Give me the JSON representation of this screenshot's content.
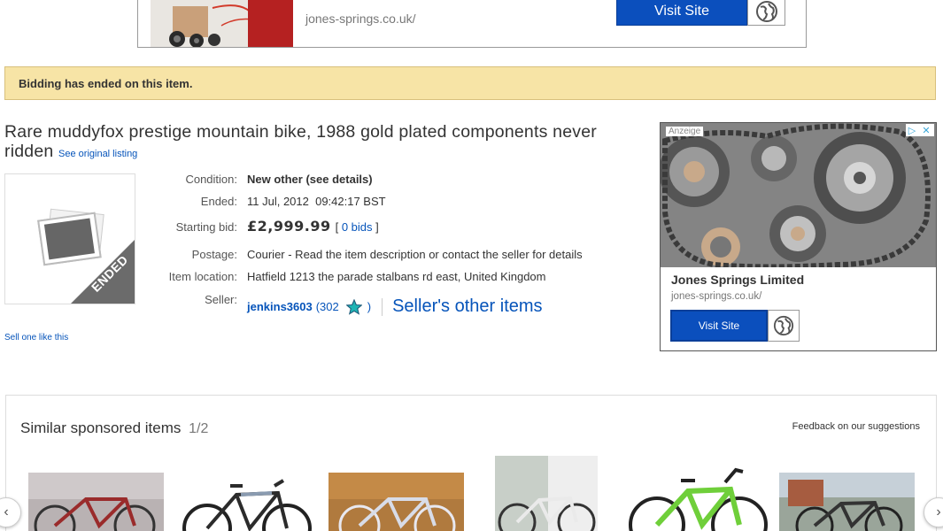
{
  "top_ad": {
    "url": "jones-springs.co.uk/",
    "button_label": "Visit Site"
  },
  "status": {
    "message": "Bidding has ended on this item."
  },
  "item": {
    "title": "Rare muddyfox prestige mountain bike, 1988 gold plated components never ridden",
    "original_link": "See original listing",
    "thumbnail_badge": "ENDED",
    "sell_link": "Sell one like this"
  },
  "details": {
    "condition_label": "Condition:",
    "condition_value": "New other (see details)",
    "ended_label": "Ended:",
    "ended_value": "11 Jul, 2012  09:42:17 BST",
    "starting_bid_label": "Starting bid:",
    "starting_bid_value": "£2,999.99",
    "bids_open": "[",
    "bids_link": "0 bids",
    "bids_close": "]",
    "postage_label": "Postage:",
    "postage_value": "Courier - Read the item description or contact the seller for details",
    "location_label": "Item location:",
    "location_value": "Hatfield 1213 the parade stalbans rd east, United Kingdom",
    "seller_label": "Seller:",
    "seller_name": "jenkins3603",
    "seller_score": "(302",
    "seller_score_close": ")",
    "seller_other_items": "Seller's other items"
  },
  "side_ad": {
    "tag": "Anzeige",
    "company": "Jones Springs Limited",
    "url": "jones-springs.co.uk/",
    "button_label": "Visit Site"
  },
  "similar": {
    "title": "Similar sponsored items",
    "page": "1/2",
    "feedback": "Feedback on our suggestions"
  },
  "colors": {
    "link": "#0654ba",
    "status_bg": "#f7e4a6",
    "ad_button": "#0b4fbd"
  }
}
